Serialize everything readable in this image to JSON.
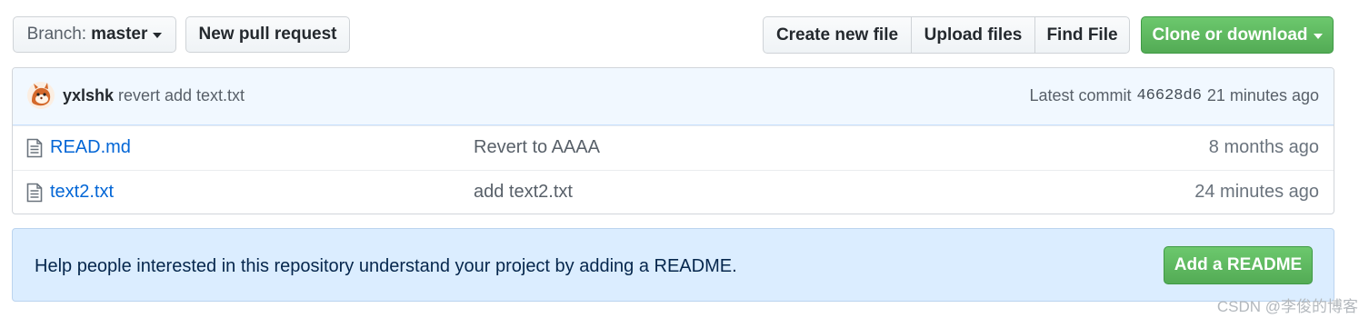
{
  "toolbar": {
    "branch_prefix": "Branch:",
    "branch_name": "master",
    "new_pull_request": "New pull request",
    "create_new_file": "Create new file",
    "upload_files": "Upload files",
    "find_file": "Find File",
    "clone_or_download": "Clone or download"
  },
  "commit": {
    "author": "yxlshk",
    "message": "revert add text.txt",
    "latest_label": "Latest commit",
    "sha": "46628d6",
    "age": "21 minutes ago"
  },
  "files": [
    {
      "name": "READ.md",
      "message": "Revert to AAAA",
      "age": "8 months ago",
      "icon": "file-icon"
    },
    {
      "name": "text2.txt",
      "message": "add text2.txt",
      "age": "24 minutes ago",
      "icon": "file-icon"
    }
  ],
  "readme_prompt": {
    "text": "Help people interested in this repository understand your project by adding a README.",
    "button": "Add a README"
  },
  "watermark": "CSDN @李俊的博客",
  "colors": {
    "accent_green": "#5cb85c",
    "link_blue": "#0366d6",
    "commit_bar_bg": "#f1f8ff",
    "readme_bg": "#dbedff"
  }
}
